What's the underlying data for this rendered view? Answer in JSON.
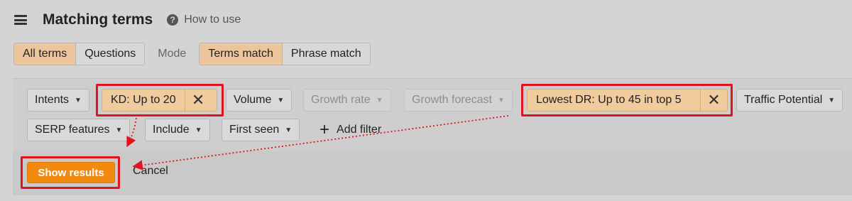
{
  "header": {
    "title": "Matching terms",
    "help_label": "How to use",
    "help_icon_glyph": "?"
  },
  "tabs": {
    "scope": [
      {
        "label": "All terms",
        "active": true
      },
      {
        "label": "Questions",
        "active": false
      }
    ],
    "mode_label": "Mode",
    "mode": [
      {
        "label": "Terms match",
        "active": true
      },
      {
        "label": "Phrase match",
        "active": false
      }
    ]
  },
  "filters": {
    "intents": "Intents",
    "kd": "KD: Up to 20",
    "volume": "Volume",
    "growth_rate": "Growth rate",
    "growth_forecast": "Growth forecast",
    "lowest_dr": "Lowest DR: Up to 45 in top 5",
    "traffic_potential": "Traffic Potential",
    "serp_features": "SERP features",
    "include": "Include",
    "first_seen": "First seen",
    "add_filter": "Add filter",
    "caret": "▼",
    "close": "✕"
  },
  "actions": {
    "show_results": "Show results",
    "cancel": "Cancel"
  },
  "colors": {
    "accent_orange": "#f28a0f",
    "applied_chip": "#efcb9e",
    "highlight_red": "#e0141e"
  }
}
